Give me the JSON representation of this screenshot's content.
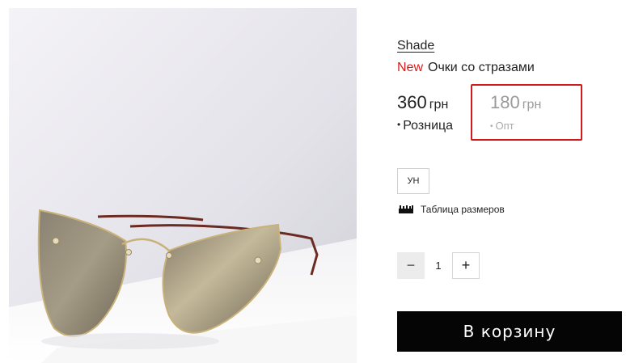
{
  "product": {
    "brand": "Shade",
    "badge": "New",
    "title": "Очки со стразами",
    "image_icon": "sunglasses-photo"
  },
  "prices": {
    "retail": {
      "amount": "360",
      "currency": "грн",
      "label": "Розница"
    },
    "wholesale": {
      "amount": "180",
      "currency": "грн",
      "label": "Опт",
      "highlight_color": "#d11a1a"
    }
  },
  "sizes": {
    "options": [
      "УН"
    ],
    "table_link": "Таблица размеров",
    "table_icon": "ruler-icon"
  },
  "quantity": {
    "minus": "−",
    "value": "1",
    "plus": "+"
  },
  "cart": {
    "button_label": "В корзину",
    "button_color": "#050505"
  },
  "colors": {
    "badge_new": "#e01a1a",
    "muted_price": "#9a9a9a"
  }
}
